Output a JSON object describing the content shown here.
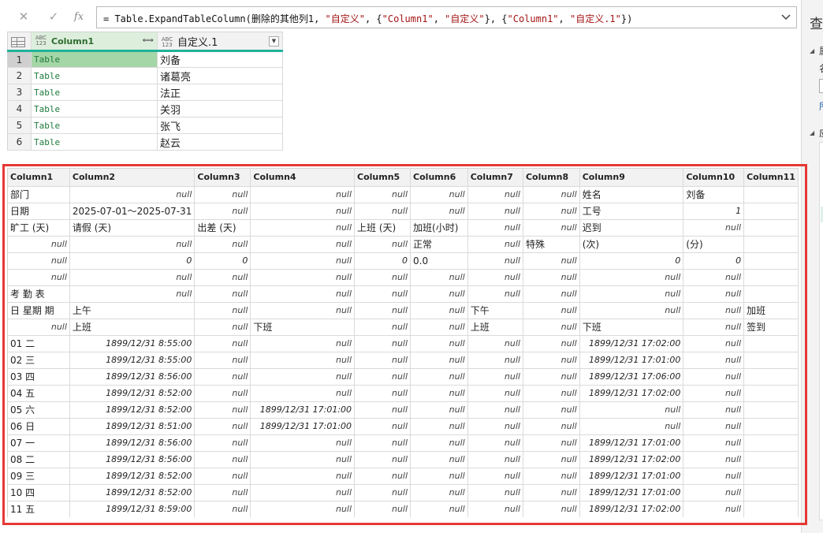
{
  "formula_bar": {
    "cancel_icon": "✕",
    "commit_icon": "✓",
    "fx_label": "fx",
    "formula_prefix": "= Table.ExpandTableColumn(删除的其他列1, ",
    "formula_arg1": "\"自定义\"",
    "formula_mid1": ", {",
    "formula_arg2": "\"Column1\"",
    "formula_mid2": ", ",
    "formula_arg3": "\"自定义\"",
    "formula_mid3": "}, {",
    "formula_arg4": "\"Column1\"",
    "formula_mid4": ", ",
    "formula_arg5": "\"自定义.1\"",
    "formula_suffix": "})"
  },
  "right_panel": {
    "title": "查",
    "section1_label": "属",
    "section1_sub": "名",
    "link_text": "所",
    "section2_label": "应"
  },
  "top_table": {
    "headers": [
      {
        "type_badge": "ABC 123",
        "label": "Column1"
      },
      {
        "type_badge": "ABC 123",
        "label": "自定义.1"
      }
    ],
    "rows": [
      {
        "num": "1",
        "c1": "Table",
        "c2": "刘备"
      },
      {
        "num": "2",
        "c1": "Table",
        "c2": "诸葛亮"
      },
      {
        "num": "3",
        "c1": "Table",
        "c2": "法正"
      },
      {
        "num": "4",
        "c1": "Table",
        "c2": "关羽"
      },
      {
        "num": "5",
        "c1": "Table",
        "c2": "张飞"
      },
      {
        "num": "6",
        "c1": "Table",
        "c2": "赵云"
      }
    ]
  },
  "preview": {
    "headers": [
      "Column1",
      "Column2",
      "Column3",
      "Column4",
      "Column5",
      "Column6",
      "Column7",
      "Column8",
      "Column9",
      "Column10",
      "Column11"
    ],
    "rows": [
      [
        "部门",
        "null",
        "null",
        "null",
        "null",
        "null",
        "null",
        "null",
        "姓名",
        "刘备",
        ""
      ],
      [
        "日期",
        "2025-07-01～2025-07-31",
        "null",
        "null",
        "null",
        "null",
        "null",
        "null",
        "工号",
        "1",
        ""
      ],
      [
        "旷工 (天)",
        "请假 (天)",
        "出差 (天)",
        "null",
        "上班 (天)",
        "加班(小时)",
        "null",
        "null",
        "迟到",
        "null",
        ""
      ],
      [
        "null",
        "null",
        "null",
        "null",
        "null",
        "正常",
        "null",
        "特殊",
        "(次)",
        "(分)",
        ""
      ],
      [
        "null",
        "0",
        "0",
        "null",
        "0",
        "0.0",
        "null",
        "null",
        "0",
        "0",
        ""
      ],
      [
        "null",
        "null",
        "null",
        "null",
        "null",
        "null",
        "null",
        "null",
        "null",
        "null",
        ""
      ],
      [
        "考 勤 表",
        "null",
        "null",
        "null",
        "null",
        "null",
        "null",
        "null",
        "null",
        "null",
        ""
      ],
      [
        "日 星期 期",
        "上午",
        "null",
        "null",
        "null",
        "null",
        "下午",
        "null",
        "null",
        "null",
        "加班"
      ],
      [
        "null",
        "上班",
        "null",
        "下班",
        "null",
        "null",
        "上班",
        "null",
        "下班",
        "null",
        "签到"
      ],
      [
        "01 二",
        "1899/12/31 8:55:00",
        "null",
        "null",
        "null",
        "null",
        "null",
        "null",
        "1899/12/31 17:02:00",
        "null",
        ""
      ],
      [
        "02 三",
        "1899/12/31 8:55:00",
        "null",
        "null",
        "null",
        "null",
        "null",
        "null",
        "1899/12/31 17:01:00",
        "null",
        ""
      ],
      [
        "03 四",
        "1899/12/31 8:56:00",
        "null",
        "null",
        "null",
        "null",
        "null",
        "null",
        "1899/12/31 17:06:00",
        "null",
        ""
      ],
      [
        "04 五",
        "1899/12/31 8:52:00",
        "null",
        "null",
        "null",
        "null",
        "null",
        "null",
        "1899/12/31 17:02:00",
        "null",
        ""
      ],
      [
        "05 六",
        "1899/12/31 8:52:00",
        "null",
        "1899/12/31 17:01:00",
        "null",
        "null",
        "null",
        "null",
        "null",
        "null",
        ""
      ],
      [
        "06 日",
        "1899/12/31 8:51:00",
        "null",
        "1899/12/31 17:01:00",
        "null",
        "null",
        "null",
        "null",
        "null",
        "null",
        ""
      ],
      [
        "07 一",
        "1899/12/31 8:56:00",
        "null",
        "null",
        "null",
        "null",
        "null",
        "null",
        "1899/12/31 17:01:00",
        "null",
        ""
      ],
      [
        "08 二",
        "1899/12/31 8:56:00",
        "null",
        "null",
        "null",
        "null",
        "null",
        "null",
        "1899/12/31 17:02:00",
        "null",
        ""
      ],
      [
        "09 三",
        "1899/12/31 8:52:00",
        "null",
        "null",
        "null",
        "null",
        "null",
        "null",
        "1899/12/31 17:01:00",
        "null",
        ""
      ],
      [
        "10 四",
        "1899/12/31 8:52:00",
        "null",
        "null",
        "null",
        "null",
        "null",
        "null",
        "1899/12/31 17:01:00",
        "null",
        ""
      ],
      [
        "11 五",
        "1899/12/31 8:59:00",
        "null",
        "null",
        "null",
        "null",
        "null",
        "null",
        "1899/12/31 17:02:00",
        "null",
        ""
      ]
    ]
  }
}
